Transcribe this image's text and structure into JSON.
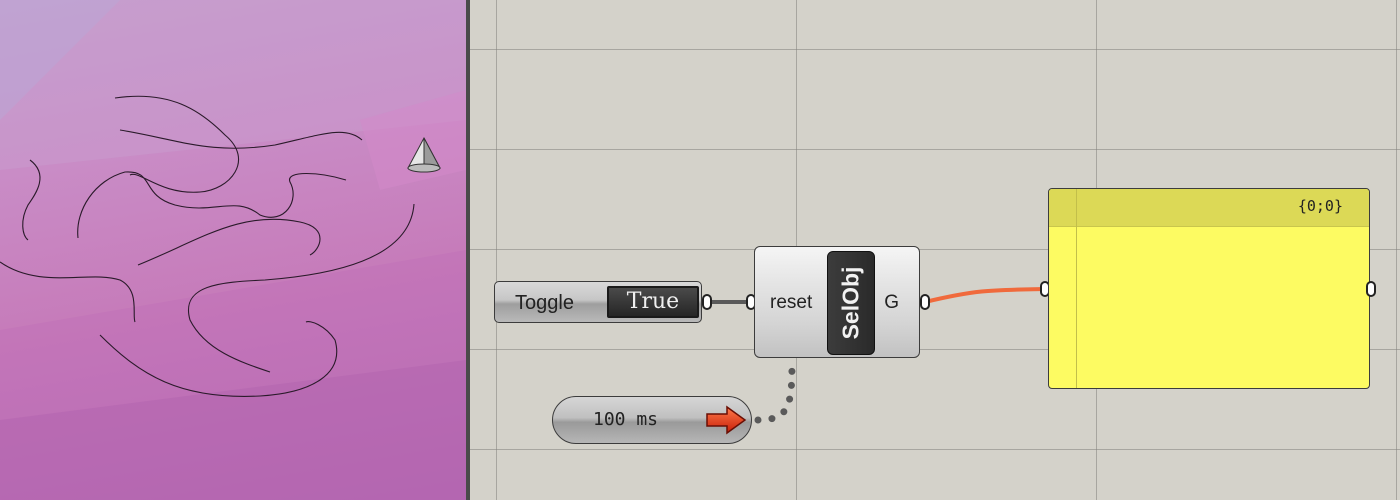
{
  "viewport": {
    "description_hidden": "",
    "cone_icon": "cone-icon"
  },
  "canvas": {
    "toggle": {
      "label": "Toggle",
      "value": "True"
    },
    "component": {
      "input": "reset",
      "nickname": "SelObj",
      "output": "G"
    },
    "timer": {
      "value": "100 ms",
      "icon": "arrow-icon"
    },
    "panel": {
      "header": "{0;0}",
      "content": ""
    },
    "colors": {
      "wire_active": "#f06a3c",
      "panel_body": "#fdfb62",
      "panel_header": "#dcd956",
      "viewport_bg": "#c67ab9",
      "canvas_bg": "#d4d2ca"
    }
  }
}
